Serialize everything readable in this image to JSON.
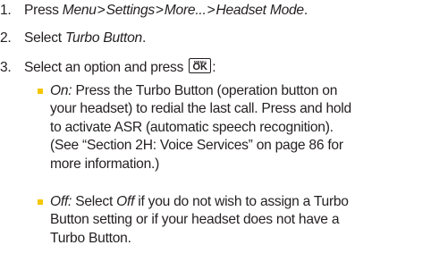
{
  "steps": [
    {
      "number": "1.",
      "text": "Press ",
      "path": [
        "Menu",
        "Settings",
        "More...",
        "Headset Mode"
      ],
      "separator": " > ",
      "end": "."
    },
    {
      "number": "2.",
      "text": "Select ",
      "item": "Turbo Button",
      "end": "."
    },
    {
      "number": "3.",
      "text": "Select an option and press ",
      "key_small": "MENU",
      "key_main": "OK",
      "end": ":"
    }
  ],
  "options": [
    {
      "label": "On:",
      "lines": [
        " Press the Turbo Button (operation button on",
        "your headset) to redial the last call. Press and hold",
        "to activate ASR (automatic speech recognition).",
        "(See “Section 2H: Voice Services” on page 86 for",
        "more information.)"
      ]
    },
    {
      "label": "Off:",
      "pre": " Select ",
      "label2": "Off",
      "lines": [
        " if you do not wish to assign a Turbo",
        "Button setting or if your headset does not have a",
        "Turbo Button."
      ]
    }
  ],
  "colors": {
    "text": "#231f20",
    "bullet": "#f6c700"
  }
}
